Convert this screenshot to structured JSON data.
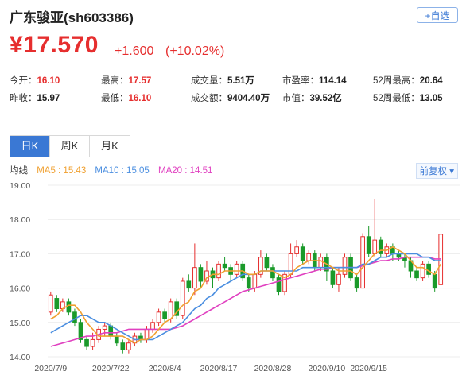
{
  "header": {
    "title": "广东骏亚(sh603386)",
    "add_label": "+自选"
  },
  "quote": {
    "price": "¥17.570",
    "change": "+1.600",
    "change_pct": "(+10.02%)"
  },
  "stats": {
    "row1": [
      {
        "label": "今开：",
        "value": "16.10",
        "color": "red"
      },
      {
        "label": "最高：",
        "value": "17.57",
        "color": "red"
      },
      {
        "label": "成交量：",
        "value": "5.51万",
        "color": "blk"
      },
      {
        "label": "市盈率：",
        "value": "114.14",
        "color": "blk"
      },
      {
        "label": "52周最高：",
        "value": "20.64",
        "color": "blk"
      }
    ],
    "row2": [
      {
        "label": "昨收：",
        "value": "15.97",
        "color": "blk"
      },
      {
        "label": "最低：",
        "value": "16.10",
        "color": "red"
      },
      {
        "label": "成交额：",
        "value": "9404.40万",
        "color": "blk"
      },
      {
        "label": "市值：",
        "value": "39.52亿",
        "color": "blk"
      },
      {
        "label": "52周最低：",
        "value": "13.05",
        "color": "blk"
      }
    ]
  },
  "tabs": [
    "日K",
    "周K",
    "月K"
  ],
  "legend": {
    "prefix": "均线",
    "ma5": "MA5 : 15.43",
    "ma10": "MA10 : 15.05",
    "ma20": "MA20 : 14.51",
    "adjust": "前复权 ▾"
  },
  "colors": {
    "up": "#e62e2e",
    "down": "#1a9a2a",
    "ma5": "#f0a030",
    "ma10": "#4a8ee0",
    "ma20": "#e040c0"
  },
  "chart_data": {
    "type": "candlestick",
    "ylim": [
      14,
      19
    ],
    "yticks": [
      "14.00",
      "15.00",
      "16.00",
      "17.00",
      "18.00",
      "19.00"
    ],
    "xticks": [
      {
        "label": "2020/7/9",
        "index": 0
      },
      {
        "label": "2020/7/22",
        "index": 10
      },
      {
        "label": "2020/8/4",
        "index": 19
      },
      {
        "label": "2020/8/17",
        "index": 28
      },
      {
        "label": "2020/8/28",
        "index": 37
      },
      {
        "label": "2020/9/10",
        "index": 46
      },
      {
        "label": "2020/9/15",
        "index": 53
      }
    ],
    "candles": [
      {
        "o": 15.3,
        "c": 15.8,
        "h": 15.9,
        "l": 15.2
      },
      {
        "o": 15.7,
        "c": 15.4,
        "h": 15.8,
        "l": 15.3
      },
      {
        "o": 15.4,
        "c": 15.6,
        "h": 15.7,
        "l": 15.3
      },
      {
        "o": 15.6,
        "c": 15.3,
        "h": 15.7,
        "l": 15.2
      },
      {
        "o": 15.3,
        "c": 15.0,
        "h": 15.4,
        "l": 14.9
      },
      {
        "o": 15.0,
        "c": 14.5,
        "h": 15.1,
        "l": 14.4
      },
      {
        "o": 14.5,
        "c": 14.3,
        "h": 14.6,
        "l": 14.2
      },
      {
        "o": 14.3,
        "c": 14.5,
        "h": 14.7,
        "l": 14.2
      },
      {
        "o": 14.5,
        "c": 14.8,
        "h": 14.9,
        "l": 14.4
      },
      {
        "o": 14.8,
        "c": 14.9,
        "h": 15.0,
        "l": 14.6
      },
      {
        "o": 14.9,
        "c": 14.6,
        "h": 15.0,
        "l": 14.5
      },
      {
        "o": 14.6,
        "c": 14.4,
        "h": 14.7,
        "l": 14.3
      },
      {
        "o": 14.4,
        "c": 14.2,
        "h": 14.5,
        "l": 14.1
      },
      {
        "o": 14.2,
        "c": 14.4,
        "h": 14.5,
        "l": 14.1
      },
      {
        "o": 14.4,
        "c": 14.6,
        "h": 14.7,
        "l": 14.3
      },
      {
        "o": 14.6,
        "c": 14.5,
        "h": 14.7,
        "l": 14.4
      },
      {
        "o": 14.5,
        "c": 14.8,
        "h": 14.9,
        "l": 14.4
      },
      {
        "o": 14.8,
        "c": 15.0,
        "h": 15.1,
        "l": 14.7
      },
      {
        "o": 15.0,
        "c": 15.3,
        "h": 15.4,
        "l": 14.9
      },
      {
        "o": 15.3,
        "c": 15.1,
        "h": 15.4,
        "l": 15.0
      },
      {
        "o": 15.1,
        "c": 15.6,
        "h": 15.7,
        "l": 15.0
      },
      {
        "o": 15.6,
        "c": 15.2,
        "h": 15.7,
        "l": 15.1
      },
      {
        "o": 15.2,
        "c": 16.2,
        "h": 16.3,
        "l": 15.1
      },
      {
        "o": 16.2,
        "c": 16.0,
        "h": 16.4,
        "l": 15.9
      },
      {
        "o": 16.0,
        "c": 16.6,
        "h": 17.3,
        "l": 15.8
      },
      {
        "o": 16.6,
        "c": 16.2,
        "h": 16.7,
        "l": 16.0
      },
      {
        "o": 16.2,
        "c": 16.5,
        "h": 16.8,
        "l": 16.1
      },
      {
        "o": 16.5,
        "c": 16.3,
        "h": 16.6,
        "l": 16.0
      },
      {
        "o": 16.3,
        "c": 16.7,
        "h": 16.8,
        "l": 16.2
      },
      {
        "o": 16.7,
        "c": 16.6,
        "h": 16.9,
        "l": 16.5
      },
      {
        "o": 16.6,
        "c": 16.4,
        "h": 16.7,
        "l": 16.2
      },
      {
        "o": 16.4,
        "c": 16.7,
        "h": 16.8,
        "l": 16.3
      },
      {
        "o": 16.7,
        "c": 16.3,
        "h": 16.8,
        "l": 16.2
      },
      {
        "o": 16.3,
        "c": 16.0,
        "h": 16.4,
        "l": 15.9
      },
      {
        "o": 16.0,
        "c": 16.4,
        "h": 16.5,
        "l": 15.9
      },
      {
        "o": 16.4,
        "c": 16.9,
        "h": 17.1,
        "l": 16.3
      },
      {
        "o": 16.9,
        "c": 16.6,
        "h": 17.0,
        "l": 16.5
      },
      {
        "o": 16.6,
        "c": 16.3,
        "h": 16.7,
        "l": 16.2
      },
      {
        "o": 16.3,
        "c": 15.9,
        "h": 16.4,
        "l": 15.8
      },
      {
        "o": 15.9,
        "c": 16.4,
        "h": 16.5,
        "l": 15.8
      },
      {
        "o": 16.4,
        "c": 17.0,
        "h": 17.3,
        "l": 16.3
      },
      {
        "o": 17.0,
        "c": 17.2,
        "h": 17.4,
        "l": 16.9
      },
      {
        "o": 17.2,
        "c": 16.8,
        "h": 17.3,
        "l": 16.7
      },
      {
        "o": 16.8,
        "c": 17.0,
        "h": 17.1,
        "l": 16.7
      },
      {
        "o": 17.0,
        "c": 16.6,
        "h": 17.1,
        "l": 16.5
      },
      {
        "o": 16.6,
        "c": 16.9,
        "h": 17.0,
        "l": 16.5
      },
      {
        "o": 16.9,
        "c": 16.5,
        "h": 17.0,
        "l": 16.2
      },
      {
        "o": 16.5,
        "c": 16.1,
        "h": 16.6,
        "l": 16.0
      },
      {
        "o": 16.1,
        "c": 16.4,
        "h": 16.6,
        "l": 15.9
      },
      {
        "o": 16.4,
        "c": 16.9,
        "h": 17.0,
        "l": 16.3
      },
      {
        "o": 16.9,
        "c": 16.3,
        "h": 17.0,
        "l": 16.2
      },
      {
        "o": 16.3,
        "c": 16.0,
        "h": 16.4,
        "l": 15.9
      },
      {
        "o": 16.0,
        "c": 17.5,
        "h": 17.6,
        "l": 16.0
      },
      {
        "o": 17.5,
        "c": 17.0,
        "h": 17.8,
        "l": 16.9
      },
      {
        "o": 17.0,
        "c": 17.4,
        "h": 18.6,
        "l": 16.9
      },
      {
        "o": 17.4,
        "c": 17.0,
        "h": 17.5,
        "l": 16.9
      },
      {
        "o": 17.0,
        "c": 17.2,
        "h": 17.3,
        "l": 16.9
      },
      {
        "o": 17.2,
        "c": 17.0,
        "h": 17.3,
        "l": 16.8
      },
      {
        "o": 17.0,
        "c": 16.9,
        "h": 17.1,
        "l": 16.8
      },
      {
        "o": 16.9,
        "c": 16.8,
        "h": 17.0,
        "l": 16.6
      },
      {
        "o": 16.8,
        "c": 16.5,
        "h": 16.9,
        "l": 16.3
      },
      {
        "o": 16.5,
        "c": 16.3,
        "h": 16.6,
        "l": 16.2
      },
      {
        "o": 16.3,
        "c": 16.7,
        "h": 16.8,
        "l": 16.2
      },
      {
        "o": 16.7,
        "c": 16.4,
        "h": 16.8,
        "l": 16.3
      },
      {
        "o": 16.4,
        "c": 16.0,
        "h": 16.5,
        "l": 15.9
      },
      {
        "o": 16.1,
        "c": 17.57,
        "h": 17.57,
        "l": 16.1
      }
    ],
    "ma5": [
      15.1,
      15.2,
      15.4,
      15.5,
      15.5,
      15.3,
      15.0,
      14.8,
      14.6,
      14.6,
      14.6,
      14.6,
      14.6,
      14.5,
      14.4,
      14.5,
      14.5,
      14.6,
      14.8,
      15.0,
      15.1,
      15.3,
      15.5,
      15.6,
      15.9,
      16.0,
      16.3,
      16.4,
      16.4,
      16.5,
      16.5,
      16.5,
      16.5,
      16.4,
      16.4,
      16.5,
      16.5,
      16.5,
      16.4,
      16.3,
      16.4,
      16.6,
      16.7,
      16.8,
      16.8,
      16.8,
      16.7,
      16.6,
      16.5,
      16.5,
      16.5,
      16.4,
      16.6,
      16.8,
      17.0,
      17.1,
      17.1,
      17.2,
      17.1,
      17.0,
      16.8,
      16.6,
      16.6,
      16.5,
      16.4,
      16.7
    ],
    "ma10": [
      14.7,
      14.8,
      14.9,
      15.0,
      15.1,
      15.2,
      15.2,
      15.1,
      15.0,
      15.0,
      14.9,
      14.8,
      14.7,
      14.6,
      14.5,
      14.5,
      14.5,
      14.5,
      14.6,
      14.7,
      14.8,
      14.9,
      15.0,
      15.2,
      15.4,
      15.5,
      15.7,
      15.8,
      16.0,
      16.1,
      16.2,
      16.3,
      16.4,
      16.4,
      16.4,
      16.5,
      16.5,
      16.5,
      16.5,
      16.5,
      16.5,
      16.5,
      16.6,
      16.6,
      16.6,
      16.6,
      16.6,
      16.6,
      16.6,
      16.6,
      16.6,
      16.6,
      16.7,
      16.7,
      16.8,
      16.9,
      16.9,
      17.0,
      17.0,
      17.0,
      17.0,
      17.0,
      16.9,
      16.9,
      16.8,
      16.8
    ],
    "ma20": [
      14.3,
      14.35,
      14.4,
      14.45,
      14.5,
      14.55,
      14.6,
      14.6,
      14.65,
      14.7,
      14.7,
      14.7,
      14.75,
      14.8,
      14.8,
      14.8,
      14.8,
      14.8,
      14.8,
      14.8,
      14.8,
      14.85,
      14.9,
      15.0,
      15.1,
      15.2,
      15.3,
      15.4,
      15.5,
      15.6,
      15.7,
      15.8,
      15.9,
      15.95,
      16.0,
      16.05,
      16.1,
      16.15,
      16.2,
      16.25,
      16.3,
      16.35,
      16.4,
      16.45,
      16.5,
      16.55,
      16.55,
      16.6,
      16.6,
      16.6,
      16.6,
      16.6,
      16.65,
      16.7,
      16.75,
      16.8,
      16.8,
      16.85,
      16.85,
      16.9,
      16.9,
      16.9,
      16.9,
      16.9,
      16.85,
      16.85
    ]
  }
}
